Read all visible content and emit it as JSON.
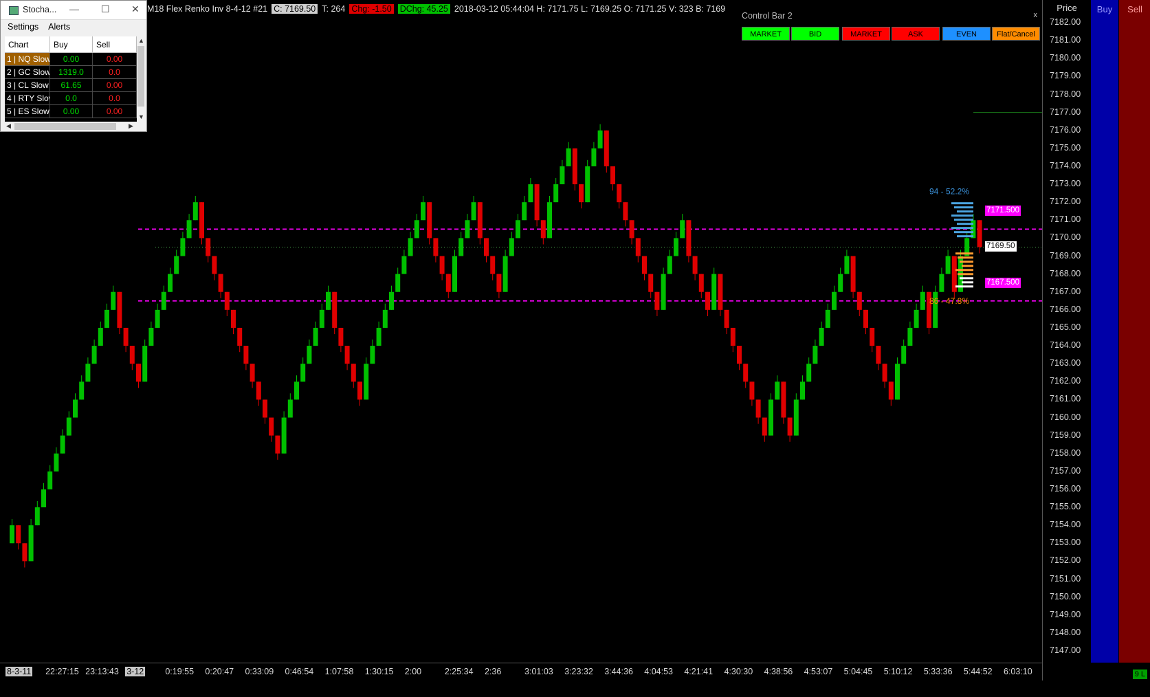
{
  "header": {
    "instrument": "M18  Flex Renko Inv 8-4-12  #21",
    "close": "C: 7169.50",
    "ticks": "T: 264",
    "chg": "Chg: -1.50",
    "dchg": "DChg: 45.25",
    "details": "2018-03-12 05:44:04 H: 7171.75 L: 7169.25 O: 7171.25 V: 323 B: 7169"
  },
  "control_bar": {
    "title": "Control Bar 2",
    "close_glyph": "x",
    "buttons": [
      {
        "label": "MARKET",
        "bg": "#00ff00"
      },
      {
        "label": "BID",
        "bg": "#00ff00"
      },
      {
        "label": "MARKET",
        "bg": "#ff0000"
      },
      {
        "label": "ASK",
        "bg": "#ff0000"
      },
      {
        "label": "EVEN",
        "bg": "#1e90ff"
      },
      {
        "label": "Flat/Cancel",
        "bg": "#ff8c00"
      }
    ]
  },
  "price_axis": {
    "title": "Price",
    "ticks": [
      "7182.00",
      "7181.00",
      "7180.00",
      "7179.00",
      "7178.00",
      "7177.00",
      "7176.00",
      "7175.00",
      "7174.00",
      "7173.00",
      "7172.00",
      "7171.00",
      "7170.00",
      "7169.00",
      "7168.00",
      "7167.00",
      "7166.00",
      "7165.00",
      "7164.00",
      "7163.00",
      "7162.00",
      "7161.00",
      "7160.00",
      "7159.00",
      "7158.00",
      "7157.00",
      "7156.00",
      "7155.00",
      "7154.00",
      "7153.00",
      "7152.00",
      "7151.00",
      "7150.00",
      "7149.00",
      "7148.00",
      "7147.00"
    ],
    "price_flags": [
      {
        "text": "7171.500",
        "price": 7171.5,
        "bg": "#ff00ff",
        "fg": "#ffffff"
      },
      {
        "text": "7169.50",
        "price": 7169.5,
        "bg": "#ffffff",
        "fg": "#000000"
      },
      {
        "text": "7167.500",
        "price": 7167.5,
        "bg": "#ff00ff",
        "fg": "#ffffff"
      }
    ]
  },
  "buy_column": {
    "title": "Buy"
  },
  "sell_column": {
    "title": "Sell"
  },
  "time_axis": {
    "labels": [
      "8-3-11",
      "22:27:15",
      "23:13:43",
      "3-12",
      "0:19:55",
      "0:20:47",
      "0:33:09",
      "0:46:54",
      "1:07:58",
      "1:30:15",
      "2:00",
      "2:25:34",
      "2:36",
      "3:01:03",
      "3:23:32",
      "3:44:36",
      "4:04:53",
      "4:21:41",
      "4:30:30",
      "4:38:56",
      "4:53:07",
      "5:04:45",
      "5:10:12",
      "5:33:36",
      "5:44:52",
      "6:03:10"
    ],
    "highlighted": [
      "8-3-11",
      "3-12"
    ]
  },
  "stochastic_window": {
    "title": "Stocha...",
    "menu": [
      "Settings",
      "Alerts"
    ],
    "columns": [
      "Chart",
      "Buy",
      "Sell"
    ],
    "rows": [
      {
        "chart": "1 | NQ Slow",
        "buy": "0.00",
        "sell": "0.00",
        "selected": true
      },
      {
        "chart": "2 | GC Slow",
        "buy": "1319.0",
        "sell": "0.0",
        "selected": false
      },
      {
        "chart": "3 | CL Slow |",
        "buy": "61.65",
        "sell": "0.00",
        "selected": false
      },
      {
        "chart": "4 | RTY Slow",
        "buy": "0.0",
        "sell": "0.0",
        "selected": false
      },
      {
        "chart": "5 | ES Slow |",
        "buy": "0.00",
        "sell": "0.00",
        "selected": false
      }
    ]
  },
  "status_chip": "9 L",
  "chart_data": {
    "type": "candlestick",
    "brick_size": 2.0,
    "colors": {
      "up": "#00c000",
      "down": "#e00000",
      "wick": "#e00000"
    },
    "y_range": [
      7146.5,
      7182.5
    ],
    "annotations": [
      {
        "text": "94 - 52.2%",
        "price": 7172.6,
        "color": "#3a8fd6"
      },
      {
        "text": "86 - 47.8%",
        "price": 7166.5,
        "color": "#ff8c00"
      }
    ],
    "levels": [
      {
        "price": 7170.5,
        "style": "dashed",
        "color": "#ff00ff"
      },
      {
        "price": 7166.5,
        "style": "dashed",
        "color": "#ff00ff"
      },
      {
        "price": 7169.5,
        "style": "dotted",
        "color": "#4caf50"
      },
      {
        "price": 7177.0,
        "style": "solid",
        "color": "#1a7a1a"
      }
    ],
    "bricks": [
      {
        "dir": "up",
        "close": 7154.0
      },
      {
        "dir": "down",
        "close": 7153.0
      },
      {
        "dir": "down",
        "close": 7152.0
      },
      {
        "dir": "up",
        "close": 7154.0
      },
      {
        "dir": "up",
        "close": 7155.0
      },
      {
        "dir": "up",
        "close": 7156.0
      },
      {
        "dir": "up",
        "close": 7157.0
      },
      {
        "dir": "up",
        "close": 7158.0
      },
      {
        "dir": "up",
        "close": 7159.0
      },
      {
        "dir": "up",
        "close": 7160.0
      },
      {
        "dir": "up",
        "close": 7161.0
      },
      {
        "dir": "up",
        "close": 7162.0
      },
      {
        "dir": "up",
        "close": 7163.0
      },
      {
        "dir": "up",
        "close": 7164.0
      },
      {
        "dir": "up",
        "close": 7165.0
      },
      {
        "dir": "up",
        "close": 7166.0
      },
      {
        "dir": "up",
        "close": 7167.0
      },
      {
        "dir": "down",
        "close": 7165.0
      },
      {
        "dir": "down",
        "close": 7164.0
      },
      {
        "dir": "down",
        "close": 7163.0
      },
      {
        "dir": "down",
        "close": 7162.0
      },
      {
        "dir": "up",
        "close": 7164.0
      },
      {
        "dir": "up",
        "close": 7165.0
      },
      {
        "dir": "up",
        "close": 7166.0
      },
      {
        "dir": "up",
        "close": 7167.0
      },
      {
        "dir": "up",
        "close": 7168.0
      },
      {
        "dir": "up",
        "close": 7169.0
      },
      {
        "dir": "up",
        "close": 7170.0
      },
      {
        "dir": "up",
        "close": 7171.0
      },
      {
        "dir": "up",
        "close": 7172.0
      },
      {
        "dir": "down",
        "close": 7170.0
      },
      {
        "dir": "down",
        "close": 7169.0
      },
      {
        "dir": "down",
        "close": 7168.0
      },
      {
        "dir": "down",
        "close": 7167.0
      },
      {
        "dir": "down",
        "close": 7166.0
      },
      {
        "dir": "down",
        "close": 7165.0
      },
      {
        "dir": "down",
        "close": 7164.0
      },
      {
        "dir": "down",
        "close": 7163.0
      },
      {
        "dir": "down",
        "close": 7162.0
      },
      {
        "dir": "down",
        "close": 7161.0
      },
      {
        "dir": "down",
        "close": 7160.0
      },
      {
        "dir": "down",
        "close": 7159.0
      },
      {
        "dir": "down",
        "close": 7158.0
      },
      {
        "dir": "up",
        "close": 7160.0
      },
      {
        "dir": "up",
        "close": 7161.0
      },
      {
        "dir": "up",
        "close": 7162.0
      },
      {
        "dir": "up",
        "close": 7163.0
      },
      {
        "dir": "up",
        "close": 7164.0
      },
      {
        "dir": "up",
        "close": 7165.0
      },
      {
        "dir": "up",
        "close": 7166.0
      },
      {
        "dir": "up",
        "close": 7167.0
      },
      {
        "dir": "down",
        "close": 7165.0
      },
      {
        "dir": "down",
        "close": 7164.0
      },
      {
        "dir": "down",
        "close": 7163.0
      },
      {
        "dir": "down",
        "close": 7162.0
      },
      {
        "dir": "down",
        "close": 7161.0
      },
      {
        "dir": "up",
        "close": 7163.0
      },
      {
        "dir": "up",
        "close": 7164.0
      },
      {
        "dir": "up",
        "close": 7165.0
      },
      {
        "dir": "up",
        "close": 7166.0
      },
      {
        "dir": "up",
        "close": 7167.0
      },
      {
        "dir": "up",
        "close": 7168.0
      },
      {
        "dir": "up",
        "close": 7169.0
      },
      {
        "dir": "up",
        "close": 7170.0
      },
      {
        "dir": "up",
        "close": 7171.0
      },
      {
        "dir": "up",
        "close": 7172.0
      },
      {
        "dir": "down",
        "close": 7170.0
      },
      {
        "dir": "down",
        "close": 7169.0
      },
      {
        "dir": "down",
        "close": 7168.0
      },
      {
        "dir": "down",
        "close": 7167.0
      },
      {
        "dir": "up",
        "close": 7169.0
      },
      {
        "dir": "up",
        "close": 7170.0
      },
      {
        "dir": "up",
        "close": 7171.0
      },
      {
        "dir": "up",
        "close": 7172.0
      },
      {
        "dir": "down",
        "close": 7170.0
      },
      {
        "dir": "down",
        "close": 7169.0
      },
      {
        "dir": "down",
        "close": 7168.0
      },
      {
        "dir": "down",
        "close": 7167.0
      },
      {
        "dir": "up",
        "close": 7169.0
      },
      {
        "dir": "up",
        "close": 7170.0
      },
      {
        "dir": "up",
        "close": 7171.0
      },
      {
        "dir": "up",
        "close": 7172.0
      },
      {
        "dir": "up",
        "close": 7173.0
      },
      {
        "dir": "down",
        "close": 7171.0
      },
      {
        "dir": "down",
        "close": 7170.0
      },
      {
        "dir": "up",
        "close": 7172.0
      },
      {
        "dir": "up",
        "close": 7173.0
      },
      {
        "dir": "up",
        "close": 7174.0
      },
      {
        "dir": "up",
        "close": 7175.0
      },
      {
        "dir": "down",
        "close": 7173.0
      },
      {
        "dir": "down",
        "close": 7172.0
      },
      {
        "dir": "up",
        "close": 7174.0
      },
      {
        "dir": "up",
        "close": 7175.0
      },
      {
        "dir": "up",
        "close": 7176.0
      },
      {
        "dir": "down",
        "close": 7174.0
      },
      {
        "dir": "down",
        "close": 7173.0
      },
      {
        "dir": "down",
        "close": 7172.0
      },
      {
        "dir": "down",
        "close": 7171.0
      },
      {
        "dir": "down",
        "close": 7170.0
      },
      {
        "dir": "down",
        "close": 7169.0
      },
      {
        "dir": "down",
        "close": 7168.0
      },
      {
        "dir": "down",
        "close": 7167.0
      },
      {
        "dir": "down",
        "close": 7166.0
      },
      {
        "dir": "up",
        "close": 7168.0
      },
      {
        "dir": "up",
        "close": 7169.0
      },
      {
        "dir": "up",
        "close": 7170.0
      },
      {
        "dir": "up",
        "close": 7171.0
      },
      {
        "dir": "down",
        "close": 7169.0
      },
      {
        "dir": "down",
        "close": 7168.0
      },
      {
        "dir": "down",
        "close": 7167.0
      },
      {
        "dir": "down",
        "close": 7166.0
      },
      {
        "dir": "up",
        "close": 7168.0
      },
      {
        "dir": "down",
        "close": 7166.0
      },
      {
        "dir": "down",
        "close": 7165.0
      },
      {
        "dir": "down",
        "close": 7164.0
      },
      {
        "dir": "down",
        "close": 7163.0
      },
      {
        "dir": "down",
        "close": 7162.0
      },
      {
        "dir": "down",
        "close": 7161.0
      },
      {
        "dir": "down",
        "close": 7160.0
      },
      {
        "dir": "down",
        "close": 7159.0
      },
      {
        "dir": "up",
        "close": 7161.0
      },
      {
        "dir": "up",
        "close": 7162.0
      },
      {
        "dir": "down",
        "close": 7160.0
      },
      {
        "dir": "down",
        "close": 7159.0
      },
      {
        "dir": "up",
        "close": 7161.0
      },
      {
        "dir": "up",
        "close": 7162.0
      },
      {
        "dir": "up",
        "close": 7163.0
      },
      {
        "dir": "up",
        "close": 7164.0
      },
      {
        "dir": "up",
        "close": 7165.0
      },
      {
        "dir": "up",
        "close": 7166.0
      },
      {
        "dir": "up",
        "close": 7167.0
      },
      {
        "dir": "up",
        "close": 7168.0
      },
      {
        "dir": "up",
        "close": 7169.0
      },
      {
        "dir": "down",
        "close": 7167.0
      },
      {
        "dir": "down",
        "close": 7166.0
      },
      {
        "dir": "down",
        "close": 7165.0
      },
      {
        "dir": "down",
        "close": 7164.0
      },
      {
        "dir": "down",
        "close": 7163.0
      },
      {
        "dir": "down",
        "close": 7162.0
      },
      {
        "dir": "down",
        "close": 7161.0
      },
      {
        "dir": "up",
        "close": 7163.0
      },
      {
        "dir": "up",
        "close": 7164.0
      },
      {
        "dir": "up",
        "close": 7165.0
      },
      {
        "dir": "up",
        "close": 7166.0
      },
      {
        "dir": "up",
        "close": 7167.0
      },
      {
        "dir": "down",
        "close": 7165.0
      },
      {
        "dir": "up",
        "close": 7167.0
      },
      {
        "dir": "up",
        "close": 7168.0
      },
      {
        "dir": "up",
        "close": 7169.0
      },
      {
        "dir": "down",
        "close": 7167.0
      },
      {
        "dir": "up",
        "close": 7169.0
      },
      {
        "dir": "up",
        "close": 7170.0
      },
      {
        "dir": "up",
        "close": 7171.0
      },
      {
        "dir": "down",
        "close": 7169.5
      }
    ]
  }
}
